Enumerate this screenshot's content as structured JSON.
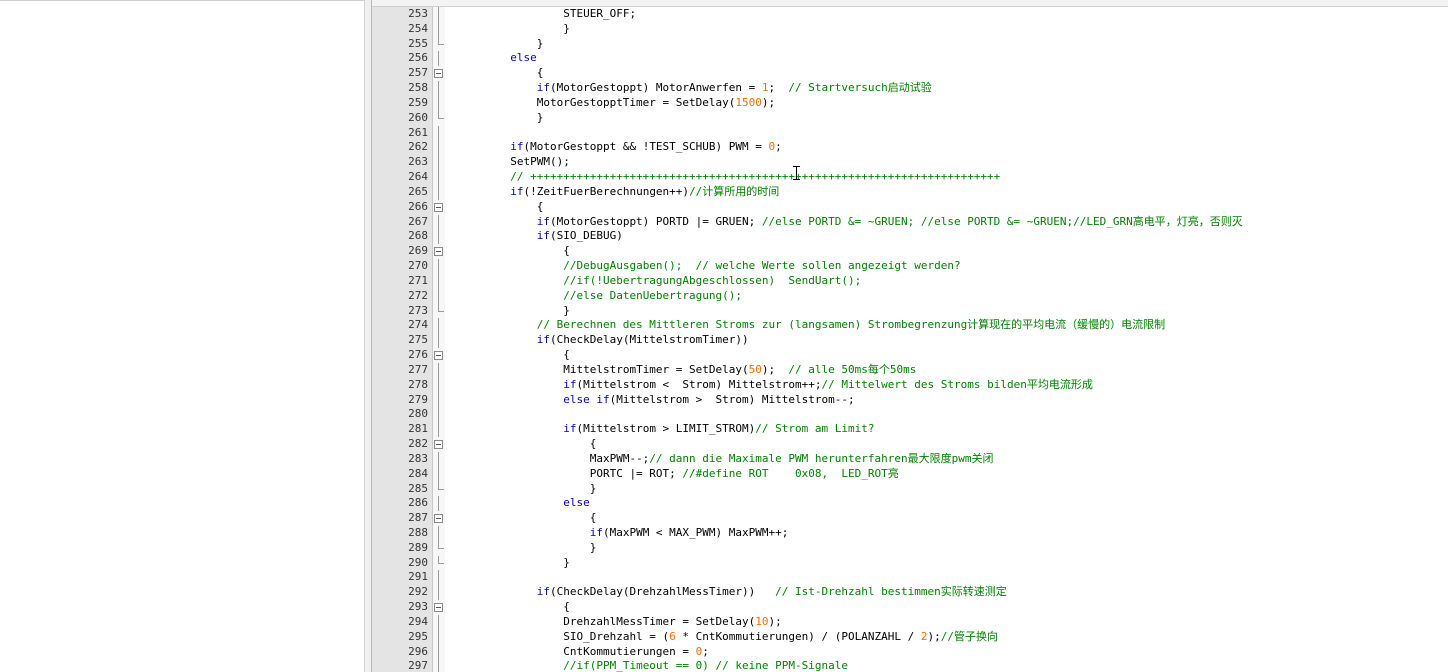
{
  "editor": {
    "lines": [
      {
        "n": "253",
        "fold": "line",
        "indent": "                  ",
        "tokens": [
          {
            "t": "STEUER_OFF;",
            "c": ""
          }
        ]
      },
      {
        "n": "254",
        "fold": "line",
        "indent": "                  ",
        "tokens": [
          {
            "t": "}",
            "c": ""
          }
        ]
      },
      {
        "n": "255",
        "fold": "end",
        "indent": "              ",
        "tokens": [
          {
            "t": "}",
            "c": ""
          }
        ]
      },
      {
        "n": "256",
        "fold": "line",
        "indent": "          ",
        "tokens": [
          {
            "t": "else",
            "c": "kw"
          }
        ]
      },
      {
        "n": "257",
        "fold": "box",
        "indent": "              ",
        "tokens": [
          {
            "t": "{",
            "c": ""
          }
        ]
      },
      {
        "n": "258",
        "fold": "line",
        "indent": "              ",
        "tokens": [
          {
            "t": "if",
            "c": "kw"
          },
          {
            "t": "(MotorGestoppt) MotorAnwerfen = ",
            "c": ""
          },
          {
            "t": "1",
            "c": "num"
          },
          {
            "t": ";  ",
            "c": ""
          },
          {
            "t": "// Startversuch启动试验",
            "c": "cm"
          }
        ]
      },
      {
        "n": "259",
        "fold": "line",
        "indent": "              ",
        "tokens": [
          {
            "t": "MotorGestopptTimer = SetDelay(",
            "c": ""
          },
          {
            "t": "1500",
            "c": "num"
          },
          {
            "t": ");",
            "c": ""
          }
        ]
      },
      {
        "n": "260",
        "fold": "end",
        "indent": "              ",
        "tokens": [
          {
            "t": "}",
            "c": ""
          }
        ]
      },
      {
        "n": "261",
        "fold": "line",
        "indent": "",
        "tokens": []
      },
      {
        "n": "262",
        "fold": "line",
        "indent": "          ",
        "tokens": [
          {
            "t": "if",
            "c": "kw"
          },
          {
            "t": "(MotorGestoppt && !TEST_SCHUB) PWM = ",
            "c": ""
          },
          {
            "t": "0",
            "c": "num"
          },
          {
            "t": ";",
            "c": ""
          }
        ]
      },
      {
        "n": "263",
        "fold": "line",
        "indent": "          ",
        "tokens": [
          {
            "t": "SetPWM();",
            "c": ""
          }
        ]
      },
      {
        "n": "264",
        "fold": "line",
        "indent": "          ",
        "tokens": [
          {
            "t": "// +++++++++++++++++++++++++++++++++++++++++++++++++++++++++++++++++++++++",
            "c": "cm"
          }
        ]
      },
      {
        "n": "265",
        "fold": "line",
        "indent": "          ",
        "tokens": [
          {
            "t": "if",
            "c": "kw"
          },
          {
            "t": "(!ZeitFuerBerechnungen++)",
            "c": ""
          },
          {
            "t": "//计算所用的时间",
            "c": "cm"
          }
        ]
      },
      {
        "n": "266",
        "fold": "box",
        "indent": "              ",
        "tokens": [
          {
            "t": "{",
            "c": ""
          }
        ]
      },
      {
        "n": "267",
        "fold": "line",
        "indent": "              ",
        "tokens": [
          {
            "t": "if",
            "c": "kw"
          },
          {
            "t": "(MotorGestoppt) PORTD |= GRUEN; ",
            "c": ""
          },
          {
            "t": "//else PORTD &= ~GRUEN; //else PORTD &= ~GRUEN;//LED_GRN高电平，灯亮，否则灭",
            "c": "cm"
          }
        ]
      },
      {
        "n": "268",
        "fold": "line",
        "indent": "              ",
        "tokens": [
          {
            "t": "if",
            "c": "kw"
          },
          {
            "t": "(SIO_DEBUG)",
            "c": ""
          }
        ]
      },
      {
        "n": "269",
        "fold": "box",
        "indent": "                  ",
        "tokens": [
          {
            "t": "{",
            "c": ""
          }
        ]
      },
      {
        "n": "270",
        "fold": "line",
        "indent": "                  ",
        "tokens": [
          {
            "t": "//DebugAusgaben();  // welche Werte sollen angezeigt werden?",
            "c": "cm"
          }
        ]
      },
      {
        "n": "271",
        "fold": "line",
        "indent": "                  ",
        "tokens": [
          {
            "t": "//if(!UebertragungAbgeschlossen)  SendUart();",
            "c": "cm"
          }
        ]
      },
      {
        "n": "272",
        "fold": "line",
        "indent": "                  ",
        "tokens": [
          {
            "t": "//else DatenUebertragung();",
            "c": "cm"
          }
        ]
      },
      {
        "n": "273",
        "fold": "end",
        "indent": "                  ",
        "tokens": [
          {
            "t": "}",
            "c": ""
          }
        ]
      },
      {
        "n": "274",
        "fold": "line",
        "indent": "              ",
        "tokens": [
          {
            "t": "// Berechnen des Mittleren Stroms zur (langsamen) Strombegrenzung计算现在的平均电流（缓慢的）电流限制",
            "c": "cm"
          }
        ]
      },
      {
        "n": "275",
        "fold": "line",
        "indent": "              ",
        "tokens": [
          {
            "t": "if",
            "c": "kw"
          },
          {
            "t": "(CheckDelay(MittelstromTimer))",
            "c": ""
          }
        ]
      },
      {
        "n": "276",
        "fold": "box",
        "indent": "                  ",
        "tokens": [
          {
            "t": "{",
            "c": ""
          }
        ]
      },
      {
        "n": "277",
        "fold": "line",
        "indent": "                  ",
        "tokens": [
          {
            "t": "MittelstromTimer = SetDelay(",
            "c": ""
          },
          {
            "t": "50",
            "c": "num"
          },
          {
            "t": ");  ",
            "c": ""
          },
          {
            "t": "// alle 50ms每个50ms",
            "c": "cm"
          }
        ]
      },
      {
        "n": "278",
        "fold": "line",
        "indent": "                  ",
        "tokens": [
          {
            "t": "if",
            "c": "kw"
          },
          {
            "t": "(Mittelstrom <  Strom) Mittelstrom++;",
            "c": ""
          },
          {
            "t": "// Mittelwert des Stroms bilden平均电流形成",
            "c": "cm"
          }
        ]
      },
      {
        "n": "279",
        "fold": "line",
        "indent": "                  ",
        "tokens": [
          {
            "t": "else if",
            "c": "kw"
          },
          {
            "t": "(Mittelstrom >  Strom) Mittelstrom--;",
            "c": ""
          }
        ]
      },
      {
        "n": "280",
        "fold": "line",
        "indent": "",
        "tokens": []
      },
      {
        "n": "281",
        "fold": "line",
        "indent": "                  ",
        "tokens": [
          {
            "t": "if",
            "c": "kw"
          },
          {
            "t": "(Mittelstrom > LIMIT_STROM)",
            "c": ""
          },
          {
            "t": "// Strom am Limit?",
            "c": "cm"
          }
        ]
      },
      {
        "n": "282",
        "fold": "box",
        "indent": "                      ",
        "tokens": [
          {
            "t": "{",
            "c": ""
          }
        ]
      },
      {
        "n": "283",
        "fold": "line",
        "indent": "                      ",
        "tokens": [
          {
            "t": "MaxPWM--;",
            "c": ""
          },
          {
            "t": "// dann die Maximale PWM herunterfahren最大限度pwm关闭",
            "c": "cm"
          }
        ]
      },
      {
        "n": "284",
        "fold": "line",
        "indent": "                      ",
        "tokens": [
          {
            "t": "PORTC |= ROT; ",
            "c": ""
          },
          {
            "t": "//#define ROT    0x08,  LED_ROT亮",
            "c": "cm"
          }
        ]
      },
      {
        "n": "285",
        "fold": "end",
        "indent": "                      ",
        "tokens": [
          {
            "t": "}",
            "c": ""
          }
        ]
      },
      {
        "n": "286",
        "fold": "line",
        "indent": "                  ",
        "tokens": [
          {
            "t": "else",
            "c": "kw"
          }
        ]
      },
      {
        "n": "287",
        "fold": "box",
        "indent": "                      ",
        "tokens": [
          {
            "t": "{",
            "c": ""
          }
        ]
      },
      {
        "n": "288",
        "fold": "line",
        "indent": "                      ",
        "tokens": [
          {
            "t": "if",
            "c": "kw"
          },
          {
            "t": "(MaxPWM < MAX_PWM) MaxPWM++;",
            "c": ""
          }
        ]
      },
      {
        "n": "289",
        "fold": "end",
        "indent": "                      ",
        "tokens": [
          {
            "t": "}",
            "c": ""
          }
        ]
      },
      {
        "n": "290",
        "fold": "end",
        "indent": "                  ",
        "tokens": [
          {
            "t": "}",
            "c": ""
          }
        ]
      },
      {
        "n": "291",
        "fold": "line",
        "indent": "",
        "tokens": []
      },
      {
        "n": "292",
        "fold": "line",
        "indent": "              ",
        "tokens": [
          {
            "t": "if",
            "c": "kw"
          },
          {
            "t": "(CheckDelay(DrehzahlMessTimer))   ",
            "c": ""
          },
          {
            "t": "// Ist-Drehzahl bestimmen实际转速测定",
            "c": "cm"
          }
        ]
      },
      {
        "n": "293",
        "fold": "box",
        "indent": "                  ",
        "tokens": [
          {
            "t": "{",
            "c": ""
          }
        ]
      },
      {
        "n": "294",
        "fold": "line",
        "indent": "                  ",
        "tokens": [
          {
            "t": "DrehzahlMessTimer = SetDelay(",
            "c": ""
          },
          {
            "t": "10",
            "c": "num"
          },
          {
            "t": ");",
            "c": ""
          }
        ]
      },
      {
        "n": "295",
        "fold": "line",
        "indent": "                  ",
        "tokens": [
          {
            "t": "SIO_Drehzahl = (",
            "c": ""
          },
          {
            "t": "6",
            "c": "num"
          },
          {
            "t": " * CntKommutierungen) / (POLANZAHL / ",
            "c": ""
          },
          {
            "t": "2",
            "c": "num"
          },
          {
            "t": ");",
            "c": ""
          },
          {
            "t": "//管子换向",
            "c": "cm"
          }
        ]
      },
      {
        "n": "296",
        "fold": "line",
        "indent": "                  ",
        "tokens": [
          {
            "t": "CntKommutierungen = ",
            "c": ""
          },
          {
            "t": "0",
            "c": "num"
          },
          {
            "t": ";",
            "c": ""
          }
        ]
      },
      {
        "n": "297",
        "fold": "line",
        "indent": "                  ",
        "tokens": [
          {
            "t": "//if(PPM_Timeout == 0) // keine PPM-Signale",
            "c": "cm"
          }
        ]
      }
    ]
  }
}
